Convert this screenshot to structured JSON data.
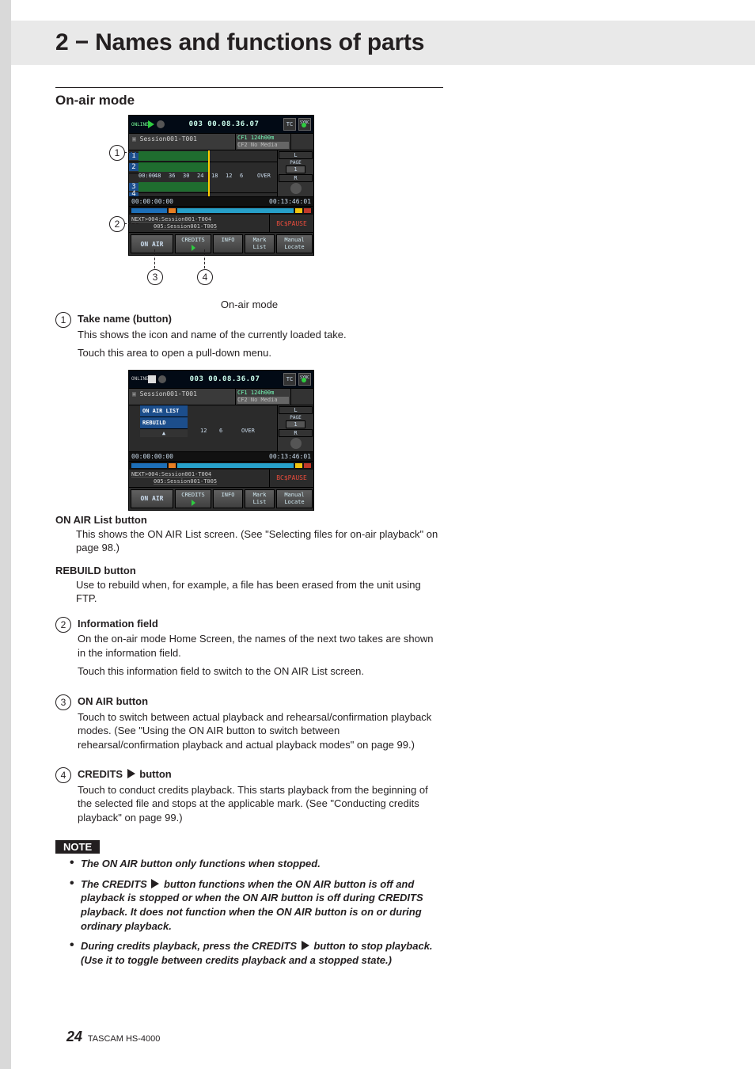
{
  "chapter_title": "2 − Names and functions of parts",
  "section_heading": "On-air mode",
  "fig1_caption": "On-air mode",
  "callouts": {
    "c1": "1",
    "c2": "2",
    "c3": "3",
    "c4": "4"
  },
  "shot": {
    "online_label": "ONLINE",
    "timecode": "003 00.08.36.07",
    "tc_box": "TC",
    "sync_box": "SYNC",
    "take_name": "Session001-T001",
    "cf1": "CF1 124h00m",
    "cf2": "CF2 No Media",
    "track_nums": {
      "t1": "1",
      "t2": "2",
      "t3": "3",
      "t4": "4"
    },
    "ruler": {
      "r0": "00:00",
      "r1": "48",
      "r2": "36",
      "r3": "30",
      "r4": "24",
      "r5": "18",
      "r6": "12",
      "r7": "6",
      "r8": "OVER"
    },
    "side_L": "L",
    "side_R": "R",
    "side_page": "PAGE",
    "side_page_no": "1",
    "time_left": "00:00:00:00",
    "time_right": "00:13:46:01",
    "next_line1": "NEXT>004:Session001-T004",
    "next_line2": "005:Session001-T005",
    "bcpause": "BC$PAUSE",
    "btn_onair": "ON AIR",
    "btn_credits": "CREDITS",
    "btn_info": "INFO",
    "btn_mark1": "Mark",
    "btn_mark2": "List",
    "btn_manual1": "Manual",
    "btn_manual2": "Locate",
    "dropdown_item1": "ON AIR LIST",
    "dropdown_item2": "REBUILD",
    "dropdown_arrow": "▲"
  },
  "item1_title": "Take name (button)",
  "item1_p1": "This shows the icon and name of the currently loaded take.",
  "item1_p2": "Touch this area to open a pull-down menu.",
  "onair_list_head": "ON AIR List button",
  "onair_list_p": "This shows the ON AIR List screen. (See \"Selecting files for on-air playback\" on page 98.)",
  "rebuild_head": "REBUILD button",
  "rebuild_p": "Use to rebuild when, for example, a file has been erased from the unit using FTP.",
  "item2_title": "Information field",
  "item2_p1": "On the on-air mode Home Screen, the names of the next two takes are shown in the information field.",
  "item2_p2": "Touch this information field to switch to the ON AIR List screen.",
  "item3_title": "ON AIR button",
  "item3_p1": "Touch to switch between actual playback and rehearsal/confirmation playback modes. (See \"Using the ON AIR button to switch between rehearsal/confirmation playback and actual playback modes\" on page 99.)",
  "item4_title_a": "CREDITS ",
  "item4_title_b": " button",
  "item4_p1": "Touch to conduct credits playback. This starts playback from the beginning of the selected file and stops at the applicable mark. (See \"Conducting credits playback\" on page 99.)",
  "note_label": "NOTE",
  "note1": "The ON AIR button only functions when stopped.",
  "note2a": "The CREDITS ",
  "note2b": " button functions when the ON AIR button is off and playback is stopped or when the ON AIR button is off during CREDITS playback. It does not function when the ON AIR button is on or during ordinary playback.",
  "note3a": "During credits playback, press the CREDITS ",
  "note3b": " button to stop playback. (Use it to toggle between credits playback and a stopped state.)",
  "page_no": "24",
  "product": "TASCAM  HS-4000"
}
